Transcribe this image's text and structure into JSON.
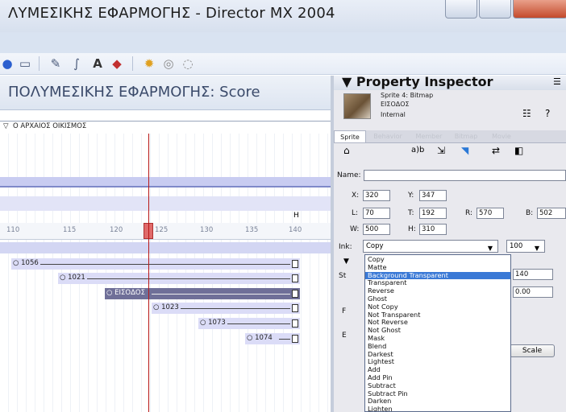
{
  "window": {
    "title": "ΛΥΜΕΣΙΚΗΣ ΕΦΑΡΜΟΓΗΣ - Director MX 2004"
  },
  "toolbar": {
    "icons": [
      "disc-icon",
      "book-icon",
      "brush-icon",
      "script-icon",
      "text-icon",
      "paint-icon",
      "sun-icon",
      "tape-icon",
      "chat-icon"
    ]
  },
  "score": {
    "title": "ΠΟΛΥΜΕΣΙΚΗΣ ΕΦΑΡΜΟΓΗΣ: Score",
    "marker_label": "Ο ΑΡΧΑΙΟΣ ΟΙΚΙΣΜΟΣ",
    "channel_letter": "H",
    "ruler_ticks": [
      "110",
      "115",
      "120",
      "125",
      "130",
      "135",
      "140"
    ],
    "sprites": [
      "1056",
      "1021",
      "ΕΙΣΟΔΟΣ",
      "1023",
      "1073",
      "1074"
    ]
  },
  "inspector": {
    "title": "Property Inspector",
    "sprite_info": [
      "Sprite 4: Bitmap",
      "ΕΙΣΟΔΟΣ",
      "Internal"
    ],
    "tabs": [
      "Sprite",
      "Behavior",
      "Member",
      "Bitmap",
      "Movie"
    ],
    "fields": {
      "name_label": "Name:",
      "name_value": "",
      "x_label": "X:",
      "x_value": "320",
      "y_label": "Y:",
      "y_value": "347",
      "l_label": "L:",
      "l_value": "70",
      "t_label": "T:",
      "t_value": "192",
      "r_label": "R:",
      "r_value": "570",
      "b_label": "B:",
      "b_value": "502",
      "w_label": "W:",
      "w_value": "500",
      "h_label": "H:",
      "h_value": "310",
      "ink_label": "Ink:",
      "ink_value": "Copy",
      "blend_value": "100",
      "start_label": "St",
      "start_value": "140",
      "rot_value": "0.00",
      "scale_button": "Scale"
    },
    "ink_options": [
      "Copy",
      "Matte",
      "Background Transparent",
      "Transparent",
      "Reverse",
      "Ghost",
      "Not Copy",
      "Not Transparent",
      "Not Reverse",
      "Not Ghost",
      "Mask",
      "Blend",
      "Darkest",
      "Lightest",
      "Add",
      "Add Pin",
      "Subtract",
      "Subtract Pin",
      "Darken",
      "Lighten"
    ],
    "selected_ink_option": "Background Transparent"
  }
}
